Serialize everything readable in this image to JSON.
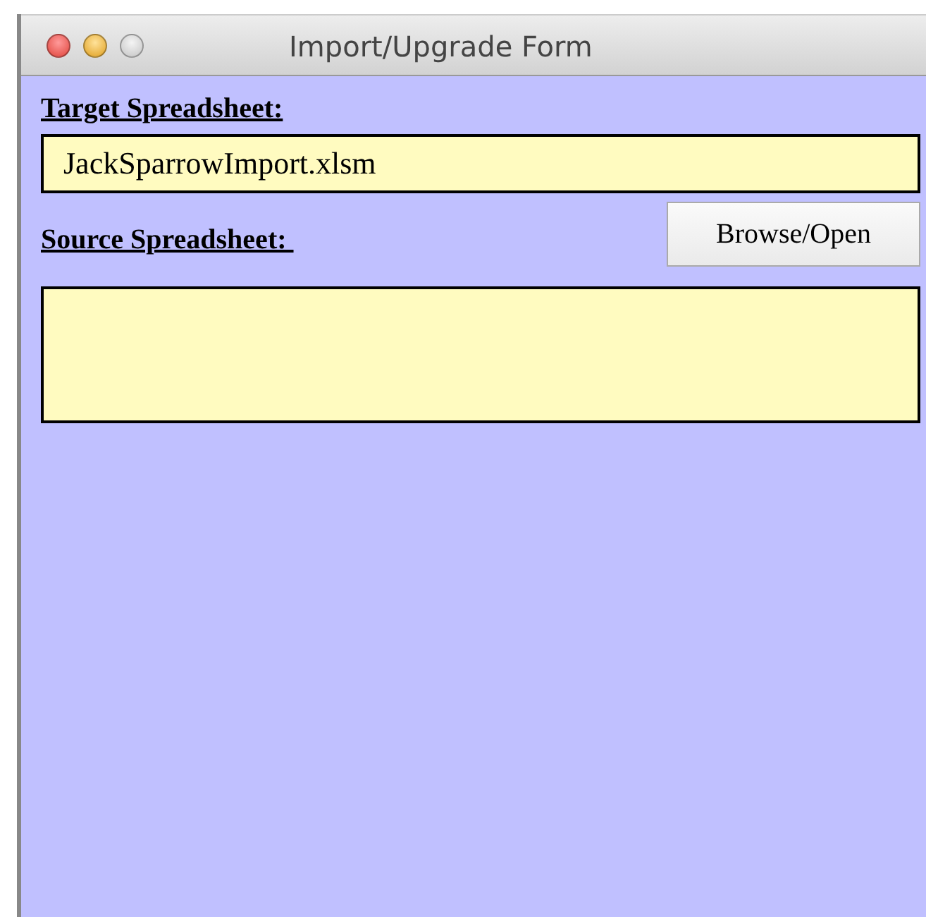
{
  "window": {
    "title": "Import/Upgrade Form"
  },
  "target": {
    "label": "Target Spreadsheet:",
    "value": "JackSparrowImport.xlsm"
  },
  "source": {
    "label": "Source Spreadsheet: ",
    "button": "Browse/Open"
  }
}
